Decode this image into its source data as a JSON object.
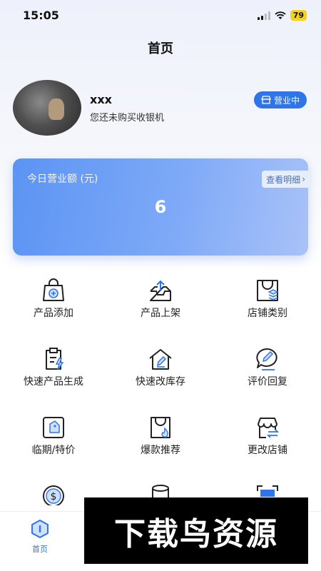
{
  "status_bar": {
    "time": "15:05",
    "battery": "79"
  },
  "header": {
    "title": "首页"
  },
  "profile": {
    "name": "xxx",
    "subtitle": "您还未购买收银机",
    "status_label": "营业中"
  },
  "revenue": {
    "label": "今日营业额 (元)",
    "detail_label": "查看明细",
    "value": "6"
  },
  "grid": {
    "items": [
      {
        "label": "产品添加",
        "icon": "bag-add-icon"
      },
      {
        "label": "产品上架",
        "icon": "tray-upload-icon"
      },
      {
        "label": "店铺类别",
        "icon": "shop-category-icon"
      },
      {
        "label": "快速产品生成",
        "icon": "clipboard-flash-icon"
      },
      {
        "label": "快速改库存",
        "icon": "house-edit-icon"
      },
      {
        "label": "评价回复",
        "icon": "comment-edit-icon"
      },
      {
        "label": "临期/特价",
        "icon": "tag-icon"
      },
      {
        "label": "爆款推荐",
        "icon": "bag-fire-icon"
      },
      {
        "label": "更改店铺",
        "icon": "store-swap-icon"
      }
    ],
    "partial_icons": [
      "dollar-coin-icon",
      "database-icon",
      "scan-icon"
    ]
  },
  "tabbar": {
    "home_label": "首页"
  },
  "watermark": {
    "text": "下载鸟资源"
  },
  "colors": {
    "accent": "#2f74e8",
    "card_start": "#5b94f4",
    "card_end": "#a9c2f8"
  }
}
